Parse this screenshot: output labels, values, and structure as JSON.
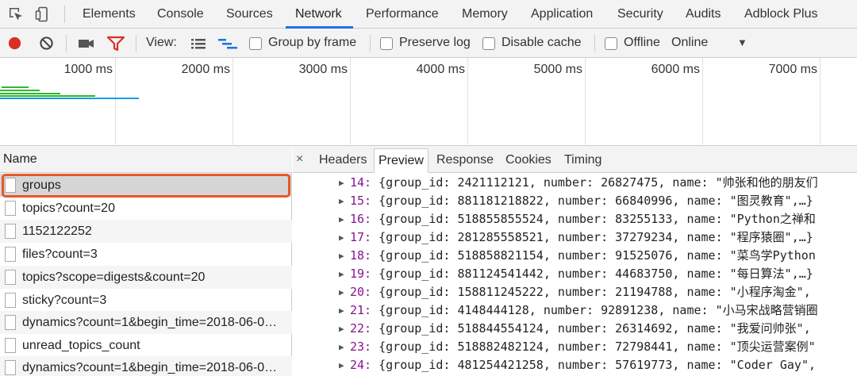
{
  "tabs": [
    "Elements",
    "Console",
    "Sources",
    "Network",
    "Performance",
    "Memory",
    "Application",
    "Security",
    "Audits",
    "Adblock Plus"
  ],
  "active_tab": "Network",
  "toolbar": {
    "view_label": "View:",
    "group_by_frame": "Group by frame",
    "preserve_log": "Preserve log",
    "disable_cache": "Disable cache",
    "offline": "Offline",
    "throttle_value": "Online",
    "dropdown_glyph": "▼",
    "record_color": "#d93025",
    "filter_color": "#d93025"
  },
  "overview": {
    "ticks": [
      "1000 ms",
      "2000 ms",
      "3000 ms",
      "4000 ms",
      "5000 ms",
      "6000 ms",
      "7000 ms"
    ]
  },
  "requests": {
    "header": "Name",
    "items": [
      "groups",
      "topics?count=20",
      "1152122252",
      "files?count=3",
      "topics?scope=digests&count=20",
      "sticky?count=3",
      "dynamics?count=1&begin_time=2018-06-0…",
      "unread_topics_count",
      "dynamics?count=1&begin_time=2018-06-0…"
    ],
    "selected": "groups"
  },
  "detail": {
    "close_glyph": "×",
    "tabs": [
      "Headers",
      "Preview",
      "Response",
      "Cookies",
      "Timing"
    ],
    "active_tab": "Preview"
  },
  "preview": {
    "rows": [
      {
        "idx": "14:",
        "text": "{group_id: 2421112121, number: 26827475, name: \"帅张和他的朋友们"
      },
      {
        "idx": "15:",
        "text": "{group_id: 881181218822, number: 66840996, name: \"图灵教育\",…}"
      },
      {
        "idx": "16:",
        "text": "{group_id: 518855855524, number: 83255133, name: \"Python之禅和"
      },
      {
        "idx": "17:",
        "text": "{group_id: 281285558521, number: 37279234, name: \"程序猿圈\",…}"
      },
      {
        "idx": "18:",
        "text": "{group_id: 518858821154, number: 91525076, name: \"菜鸟学Python"
      },
      {
        "idx": "19:",
        "text": "{group_id: 881124541442, number: 44683750, name: \"每日算法\",…}"
      },
      {
        "idx": "20:",
        "text": "{group_id: 158811245222, number: 21194788, name: \"小程序淘金\","
      },
      {
        "idx": "21:",
        "text": "{group_id: 4148444128, number: 92891238, name: \"小马宋战略营销圈"
      },
      {
        "idx": "22:",
        "text": "{group_id: 518844554124, number: 26314692, name: \"我爱问帅张\","
      },
      {
        "idx": "23:",
        "text": "{group_id: 518882482124, number: 72798441, name: \"顶尖运营案例\""
      },
      {
        "idx": "24:",
        "text": "{group_id: 481254421258, number: 57619773, name: \"Coder Gay\","
      }
    ]
  }
}
